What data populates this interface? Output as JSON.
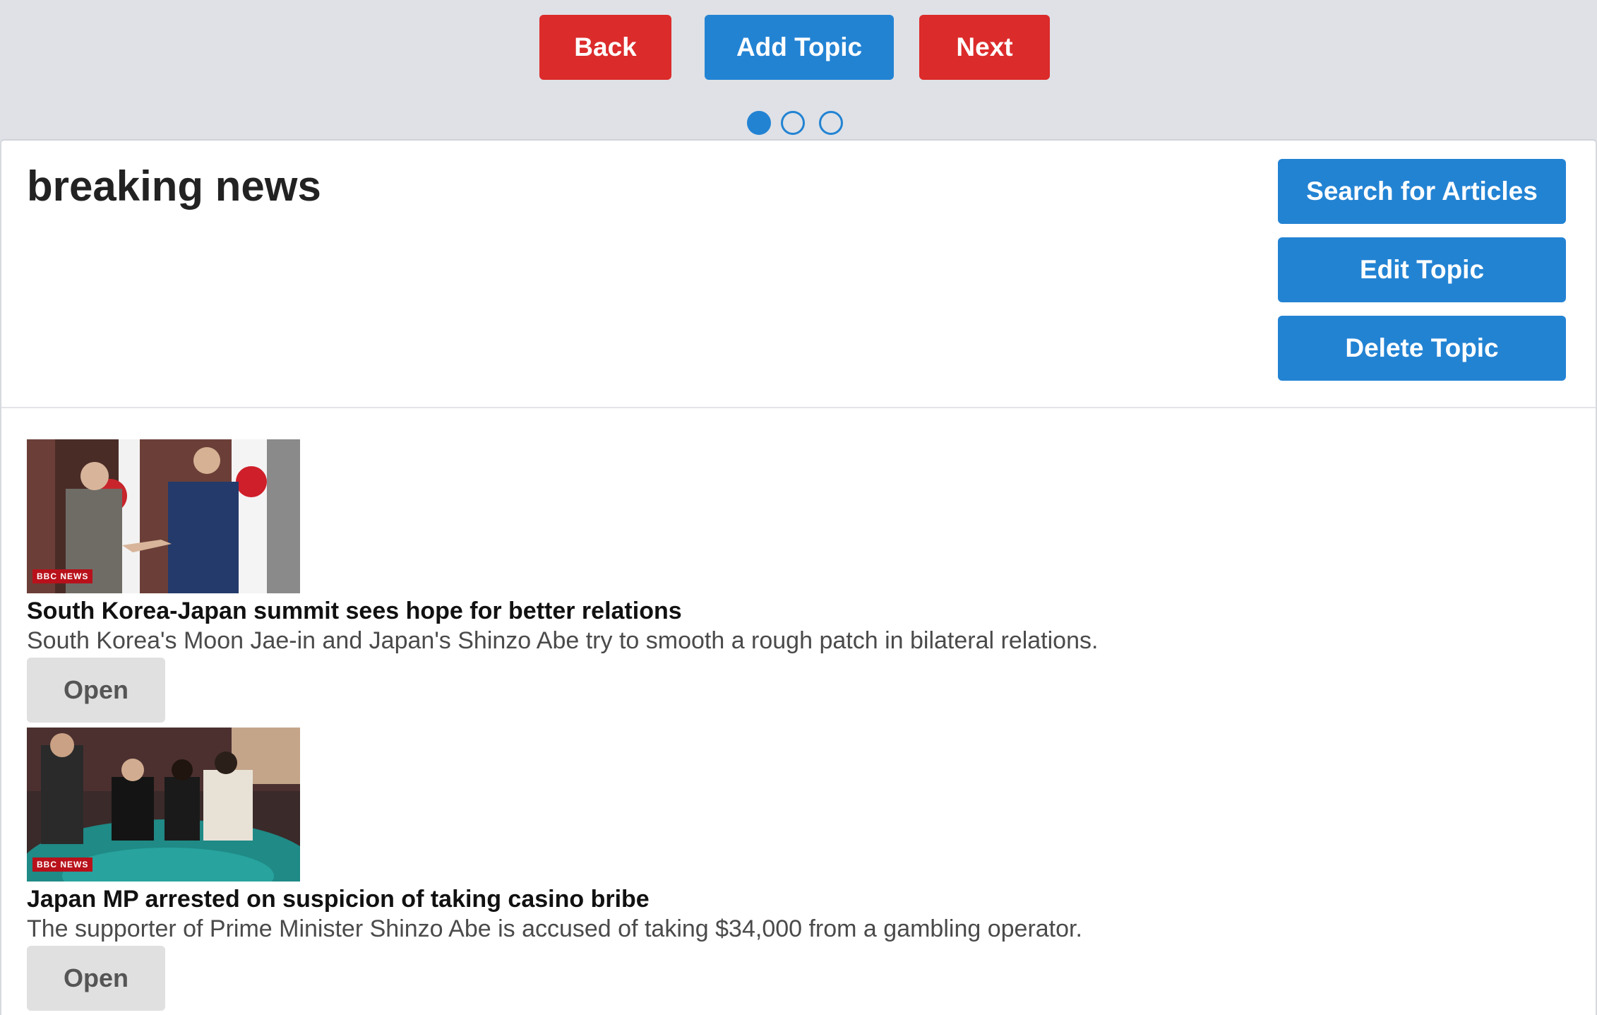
{
  "nav": {
    "back_label": "Back",
    "add_topic_label": "Add Topic",
    "next_label": "Next",
    "pager": {
      "total_pages": 3,
      "current_page": 1
    }
  },
  "topic": {
    "title": "breaking news",
    "search_label": "Search for Articles",
    "edit_label": "Edit Topic",
    "delete_label": "Delete Topic"
  },
  "articles": [
    {
      "image_badge": "BBC NEWS",
      "title": "South Korea-Japan summit sees hope for better relations",
      "description": "South Korea's Moon Jae-in and Japan's Shinzo Abe try to smooth a rough patch in bilateral relations.",
      "open_label": "Open"
    },
    {
      "image_badge": "BBC NEWS",
      "title": "Japan MP arrested on suspicion of taking casino bribe",
      "description": "The supporter of Prime Minister Shinzo Abe is accused of taking $34,000 from a gambling operator.",
      "open_label": "Open"
    }
  ],
  "colors": {
    "red_button": "#dc2b2b",
    "blue_button": "#2383d3",
    "open_button": "#e0e0e0",
    "background": "#dfe1e6"
  }
}
